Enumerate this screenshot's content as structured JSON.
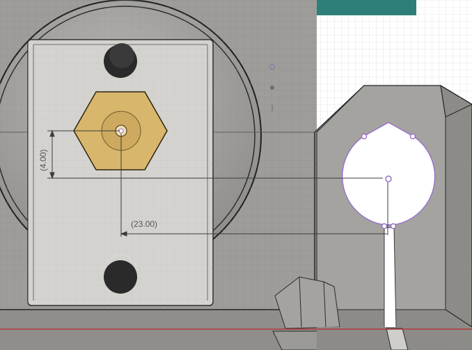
{
  "canvas": {
    "background": "#ffffff",
    "grid_color": "#dcdcdc",
    "body_color": "#a9a8a4",
    "plate_color": "#d6d5d1",
    "hex_color": "#d9b76a",
    "teal_color": "#2e7f7a",
    "sketch_color": "#9a72c9",
    "axis_color": "#b33a3a"
  },
  "dimensions": {
    "vertical": "(4.00)",
    "horizontal": "(23.00)"
  }
}
